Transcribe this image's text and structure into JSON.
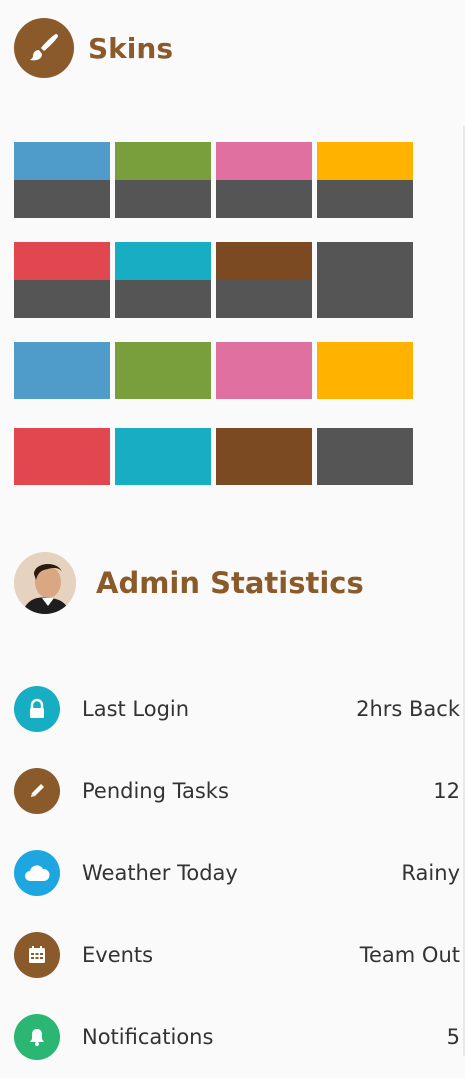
{
  "skins": {
    "title": "Skins",
    "icon": "paintbrush-icon",
    "swatches": [
      {
        "top": "#4f9bc9",
        "bottom": "#555555"
      },
      {
        "top": "#789f3b",
        "bottom": "#555555"
      },
      {
        "top": "#e0709f",
        "bottom": "#555555"
      },
      {
        "top": "#ffb300",
        "bottom": "#555555"
      },
      {
        "top": "#e0474e",
        "bottom": "#555555"
      },
      {
        "top": "#17adc2",
        "bottom": "#555555"
      },
      {
        "top": "#7b4a22",
        "bottom": "#555555"
      },
      {
        "top": "#555555",
        "bottom": "#555555"
      },
      {
        "top": "#4f9bc9"
      },
      {
        "top": "#789f3b"
      },
      {
        "top": "#e0709f"
      },
      {
        "top": "#ffb300"
      },
      {
        "top": "#e0474e"
      },
      {
        "top": "#17adc2"
      },
      {
        "top": "#7b4a22"
      },
      {
        "top": "#555555"
      }
    ]
  },
  "admin": {
    "title": "Admin Statistics",
    "stats": [
      {
        "label": "Last Login",
        "value": "2hrs Back",
        "icon": "lock-icon",
        "color": "#17adc2"
      },
      {
        "label": "Pending Tasks",
        "value": "12",
        "icon": "pencil-icon",
        "color": "#8b5a2b"
      },
      {
        "label": "Weather Today",
        "value": "Rainy",
        "icon": "cloud-icon",
        "color": "#1ea6e0"
      },
      {
        "label": "Events",
        "value": "Team Out",
        "icon": "calendar-icon",
        "color": "#8b5a2b"
      },
      {
        "label": "Notifications",
        "value": "5",
        "icon": "bell-icon",
        "color": "#2bb673"
      }
    ]
  },
  "colors": {
    "accent": "#8b5a2b",
    "text": "#333333"
  }
}
